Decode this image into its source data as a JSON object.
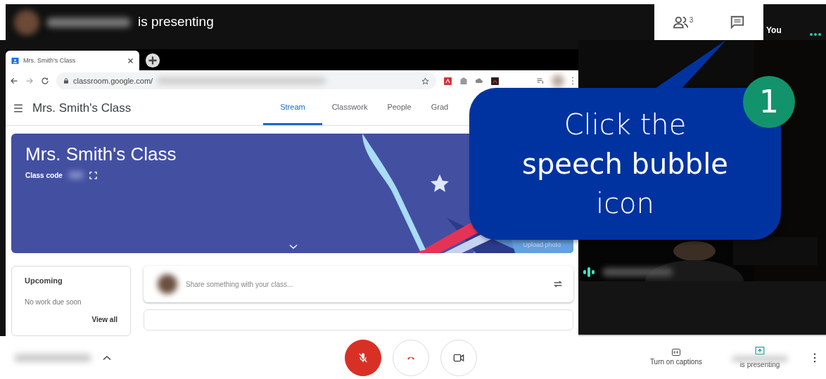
{
  "presenter_bar": {
    "text": "is presenting"
  },
  "meeting_panel": {
    "people_count": "3",
    "you_label": "You"
  },
  "browser": {
    "tab_title": "Mrs. Smith's Class",
    "url": "classroom.google.com/"
  },
  "classroom": {
    "title": "Mrs. Smith's Class",
    "tabs": [
      {
        "label": "Stream",
        "selected": true
      },
      {
        "label": "Classwork",
        "selected": false
      },
      {
        "label": "People",
        "selected": false
      },
      {
        "label": "Grad",
        "selected": false
      }
    ],
    "banner": {
      "title": "Mrs. Smith's Class",
      "class_code_label": "Class code",
      "upload_label": "Upload photo"
    },
    "upcoming": {
      "title": "Upcoming",
      "text": "No work due soon",
      "link": "View all"
    },
    "share": {
      "placeholder": "Share something with your class..."
    }
  },
  "callout": {
    "number": "1",
    "lines": [
      "Click the",
      "**speech bubble**",
      "icon"
    ]
  },
  "controls": {
    "mic_muted": true,
    "captions_label": "Turn on captions",
    "presenting_label": "is presenting"
  }
}
